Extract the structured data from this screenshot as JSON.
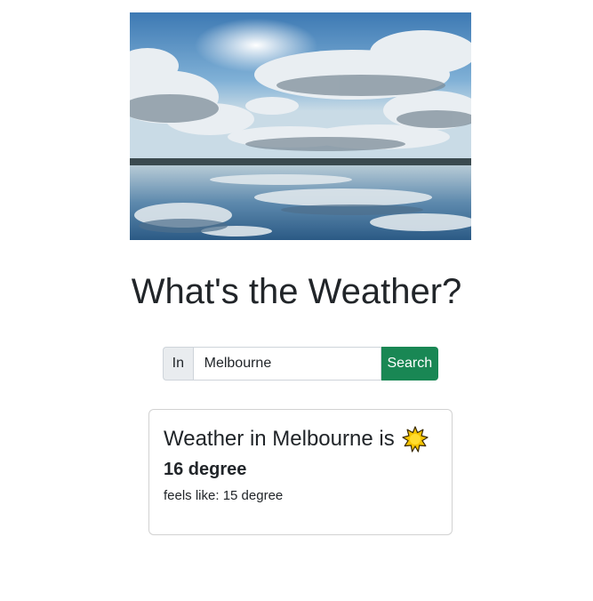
{
  "hero": {
    "image_alt": "sky and clouds reflected on a lake",
    "icon": "landscape-image"
  },
  "page": {
    "title": "What's the Weather?"
  },
  "search": {
    "prefix_label": "In",
    "input_value": "Melbourne",
    "button_label": "Search",
    "button_color": "#198754"
  },
  "result": {
    "heading": "Weather in Melbourne is",
    "weather_icon": "sun-icon",
    "temperature": "16 degree",
    "feels_like": "feels like: 15 degree"
  }
}
